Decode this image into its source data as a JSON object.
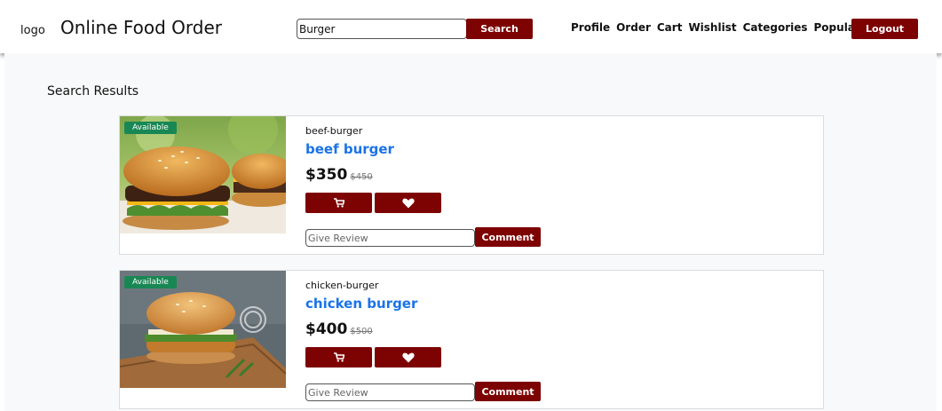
{
  "header": {
    "logo": "logo",
    "brand": "Online Food Order",
    "search_value": "Burger",
    "search_button": "Search",
    "nav": [
      "Profile",
      "Order",
      "Cart",
      "Wishlist",
      "Categories",
      "Popular"
    ],
    "logout": "Logout"
  },
  "results": {
    "title": "Search Results",
    "items": [
      {
        "badge": "Available",
        "slug": "beef-burger",
        "name": "beef burger",
        "price": "$350",
        "old_price": "$450",
        "review_placeholder": "Give Review",
        "comment": "Comment",
        "image": "beef-burger-photo"
      },
      {
        "badge": "Available",
        "slug": "chicken-burger",
        "name": "chicken burger",
        "price": "$400",
        "old_price": "$500",
        "review_placeholder": "Give Review",
        "comment": "Comment",
        "image": "chicken-burger-photo"
      }
    ]
  },
  "icons": {
    "cart": "cart-icon",
    "wishlist": "heart-icon"
  },
  "colors": {
    "primary": "#7d0202",
    "badge": "#198754",
    "link": "#1a73e8"
  }
}
